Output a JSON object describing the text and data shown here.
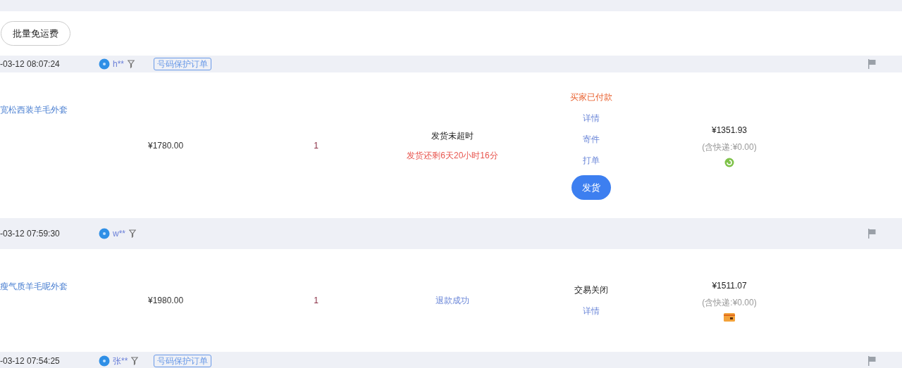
{
  "toolbar": {
    "button": "批量免运费"
  },
  "orders": [
    {
      "time": "-03-12 08:07:24",
      "buyer": "h**",
      "tag": "号码保护订单",
      "product": "宽松西装羊毛外套",
      "price": "¥1780.00",
      "qty": "1",
      "shipping": [
        {
          "kind": "plain",
          "text": "发货未超时"
        },
        {
          "kind": "warning",
          "text": "发货还剩6天20小时16分"
        }
      ],
      "actions": [
        {
          "kind": "status-alert",
          "text": "买家已付款"
        },
        {
          "kind": "link",
          "text": "详情"
        },
        {
          "kind": "link",
          "text": "寄件"
        },
        {
          "kind": "link",
          "text": "打单"
        },
        {
          "kind": "button",
          "text": "发货"
        }
      ],
      "total": "¥1351.93",
      "freight": "(含快递:¥0.00)",
      "payment": {
        "kind": "round"
      }
    },
    {
      "time": "-03-12 07:59:30",
      "buyer": "w**",
      "product": "瘦气质羊毛呢外套",
      "price": "¥1980.00",
      "qty": "1",
      "shipping": [
        {
          "kind": "link",
          "text": "退款成功"
        }
      ],
      "actions": [
        {
          "kind": "status",
          "text": "交易关闭"
        },
        {
          "kind": "link",
          "text": "详情"
        }
      ],
      "total": "¥1511.07",
      "freight": "(含快递:¥0.00)",
      "payment": {
        "kind": "card"
      }
    },
    {
      "time": "-03-12 07:54:25",
      "buyer": "张**",
      "tag": "号码保护订单"
    }
  ]
}
